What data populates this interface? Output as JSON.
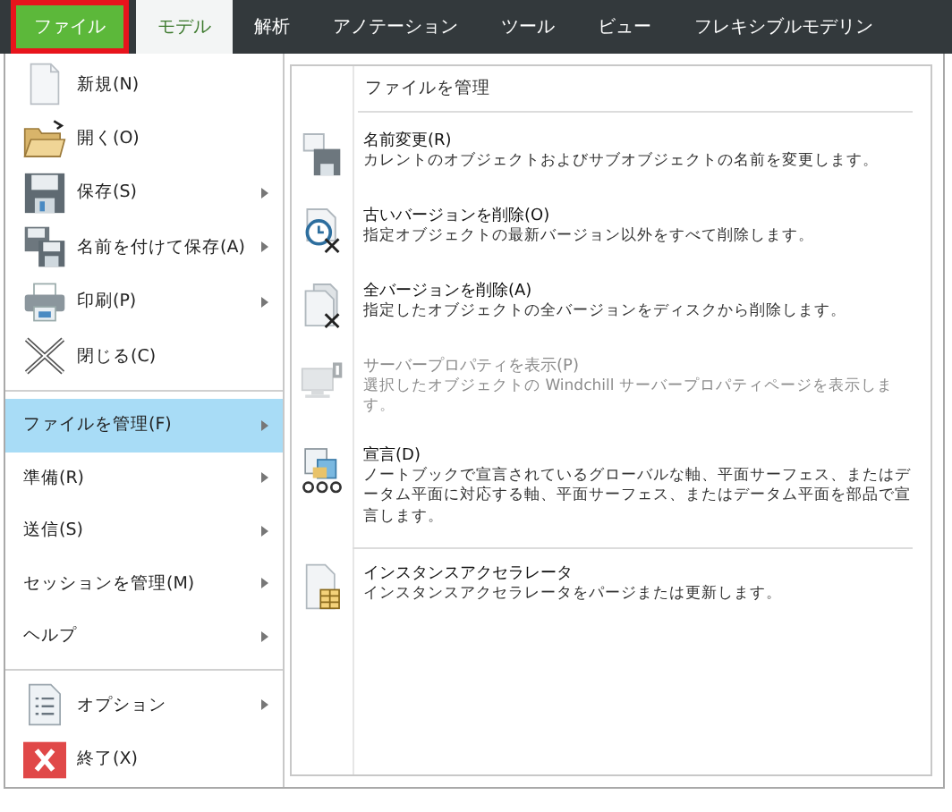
{
  "ribbon_tabs": [
    {
      "label": "ファイル",
      "kind": "file",
      "selected": true
    },
    {
      "label": "モデル",
      "kind": "tab",
      "selected": true
    },
    {
      "label": "解析",
      "kind": "tab",
      "selected": false
    },
    {
      "label": "アノテーション",
      "kind": "tab",
      "selected": false
    },
    {
      "label": "ツール",
      "kind": "tab",
      "selected": false
    },
    {
      "label": "ビュー",
      "kind": "tab",
      "selected": false
    },
    {
      "label": "フレキシブルモデリン",
      "kind": "tab",
      "selected": false
    }
  ],
  "file_menu": {
    "groups": [
      [
        {
          "label": "新規(N)",
          "kind": "icon",
          "submenu": false,
          "selected": false
        },
        {
          "label": "開く(O)",
          "kind": "icon",
          "submenu": false,
          "selected": false
        },
        {
          "label": "保存(S)",
          "kind": "icon",
          "submenu": true,
          "selected": false
        },
        {
          "label": "名前を付けて保存(A)",
          "kind": "icon",
          "submenu": true,
          "selected": false
        },
        {
          "label": "印刷(P)",
          "kind": "icon",
          "submenu": true,
          "selected": false
        },
        {
          "label": "閉じる(C)",
          "kind": "icon",
          "submenu": false,
          "selected": false
        }
      ],
      [
        {
          "label": "ファイルを管理(F)",
          "kind": "text",
          "submenu": true,
          "selected": true
        },
        {
          "label": "準備(R)",
          "kind": "text",
          "submenu": true,
          "selected": false
        },
        {
          "label": "送信(S)",
          "kind": "text",
          "submenu": true,
          "selected": false
        },
        {
          "label": "セッションを管理(M)",
          "kind": "text",
          "submenu": true,
          "selected": false
        },
        {
          "label": "ヘルプ",
          "kind": "text",
          "submenu": true,
          "selected": false
        }
      ],
      [
        {
          "label": "オプション",
          "kind": "icon",
          "submenu": true,
          "selected": false
        },
        {
          "label": "終了(X)",
          "kind": "icon",
          "submenu": false,
          "selected": false
        }
      ]
    ]
  },
  "submenu": {
    "title": "ファイルを管理",
    "items": [
      {
        "title": "名前変更(R)",
        "description": "カレントのオブジェクトおよびサブオブジェクトの名前を変更します。",
        "disabled": false,
        "separator_before": false
      },
      {
        "title": "古いバージョンを削除(O)",
        "description": "指定オブジェクトの最新バージョン以外をすべて削除します。",
        "disabled": false,
        "separator_before": false
      },
      {
        "title": "全バージョンを削除(A)",
        "description": "指定したオブジェクトの全バージョンをディスクから削除します。",
        "disabled": false,
        "separator_before": false
      },
      {
        "title": "サーバープロパティを表示(P)",
        "description": "選択したオブジェクトの Windchill サーバープロパティページを表示します。",
        "disabled": true,
        "separator_before": false
      },
      {
        "title": "宣言(D)",
        "description": "ノートブックで宣言されているグローバルな軸、平面サーフェス、またはデータム平面に対応する軸、平面サーフェス、またはデータム平面を部品で宣言します。",
        "disabled": false,
        "separator_before": false
      },
      {
        "title": "インスタンスアクセラレータ",
        "description": "インスタンスアクセラレータをパージまたは更新します。",
        "disabled": false,
        "separator_before": true
      }
    ]
  }
}
